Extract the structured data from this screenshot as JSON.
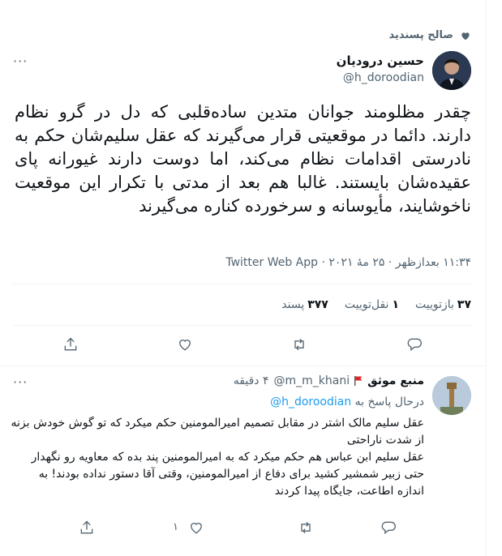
{
  "liked_by": {
    "text": "صالح پسندید",
    "icon": "heart-icon"
  },
  "tweet": {
    "author_name": "حسین درودیان",
    "author_handle": "@h_doroodian",
    "text": "چقدر مظلومند جوانان متدین ساده‌قلبی که دل در گرو نظام دارند. دائما در موقعیتی قرار می‌گیرند که عقل سلیم‌شان حکم به نادرستی اقدامات نظام می‌کند، اما دوست دارند غیورانه پای عقیده‌شان بایستند. غالبا هم بعد از مدتی با تکرار این موقعیت ناخوشایند، مأیوسانه و سرخورده کناره می‌گیرند",
    "meta": "۱۱:۳۴ بعدازظهر · ۲۵ مهٔ ۲۰۲۱ · Twitter Web App",
    "stats": {
      "retweets_count": "۳۷",
      "retweets_label": "بازتوییت",
      "quotes_count": "۱",
      "quotes_label": "نقل‌توییت",
      "likes_count": "۳۷۷",
      "likes_label": "پسند"
    }
  },
  "reply": {
    "author_name": "منبع موثق",
    "author_handle": "@m_m_khani",
    "time": "۴ دقیقه",
    "replying_prefix": "درحال پاسخ به",
    "replying_to": "@h_doroodian",
    "lines": [
      "عقل سلیم مالک اشتر در مقابل تصمیم امیرالمومنین حکم میکرد که تو گوش خودش بزنه از شدت ناراحتی",
      "عقل سلیم ابن عباس هم حکم میکرد که به امیرالمومنین پند بده که معاویه رو نگهدار",
      "حتی زبیر شمشیر کشید برای دفاع از امیرالمومنین، وقتی آقا دستور نداده بودند! به اندازه اطاعت، جایگاه پیدا کردند"
    ],
    "like_count": "۱"
  }
}
